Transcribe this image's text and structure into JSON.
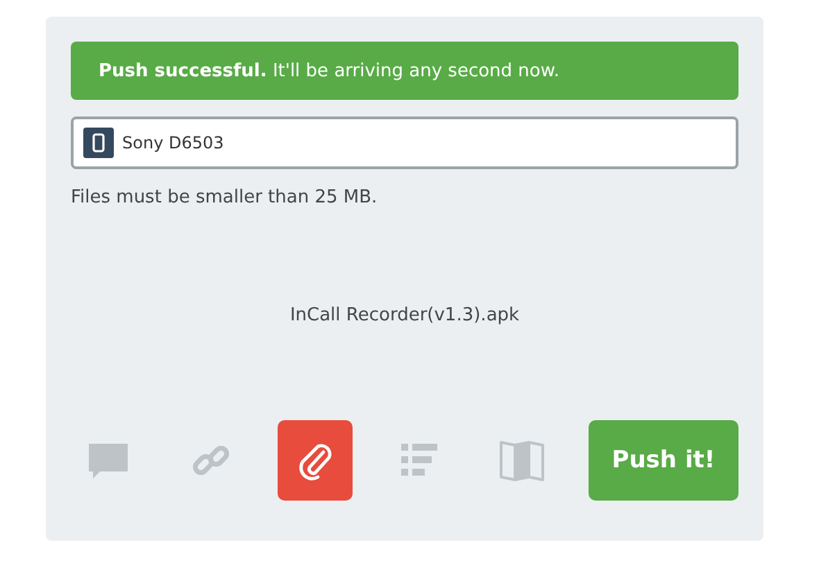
{
  "banner": {
    "text": "**Push successful.** It'll be arriving any second now."
  },
  "device": {
    "name": "Sony D6503"
  },
  "file_hint": "Files must be smaller than 25 MB.",
  "file_name": "InCall Recorder(v1.3).apk",
  "push_types": [
    {
      "kind": "note",
      "selected": false
    },
    {
      "kind": "link",
      "selected": false
    },
    {
      "kind": "file",
      "selected": true
    },
    {
      "kind": "list",
      "selected": false
    },
    {
      "kind": "address",
      "selected": false
    }
  ],
  "push_button": "Push it!"
}
